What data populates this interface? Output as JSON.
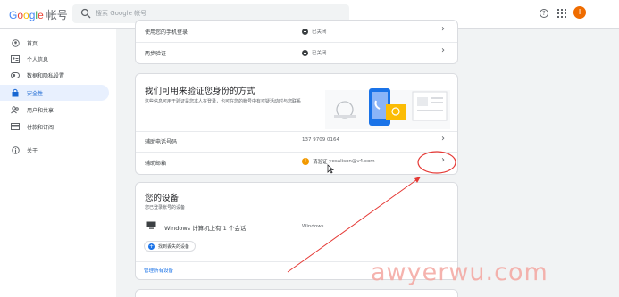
{
  "header": {
    "logo_letters": [
      "G",
      "o",
      "o",
      "g",
      "l",
      "e"
    ],
    "logo_suffix": "帐号",
    "search_placeholder": "搜索 Google 帐号",
    "help_symbol": "?",
    "avatar_letter": "I",
    "avatar_color": "#ef6c00"
  },
  "sidebar": {
    "items": [
      {
        "label": "首页",
        "icon": "account-circle-icon"
      },
      {
        "label": "个人信息",
        "icon": "id-card-icon"
      },
      {
        "label": "数据和隐私设置",
        "icon": "toggle-icon"
      },
      {
        "label": "安全性",
        "icon": "lock-icon",
        "active": true
      },
      {
        "label": "用户和共享",
        "icon": "people-icon"
      },
      {
        "label": "付款和订阅",
        "icon": "credit-card-icon"
      },
      {
        "label": "关于",
        "icon": "info-icon"
      }
    ]
  },
  "signin_card": {
    "rows": [
      {
        "label": "使用您的手机登录",
        "status": "已关闭"
      },
      {
        "label": "两步验证",
        "status": "已关闭"
      }
    ]
  },
  "verify_card": {
    "title": "我们可用来验证您身份的方式",
    "description": "这些信息可用于验证是您本人在登录，也可在您的帐号中有可疑活动时与您联系",
    "rows": [
      {
        "label": "辅助电话号码",
        "value": "137 9709 0164"
      },
      {
        "label": "辅助邮箱",
        "status_prefix": "请验证",
        "value": "yesalison@v4.com"
      }
    ]
  },
  "devices_card": {
    "title": "您的设备",
    "subtitle": "您已登录帐号的设备",
    "device_label": "Windows 计算机上有 1 个会话",
    "device_os": "Windows",
    "find_button": "找到丢失的设备",
    "manage_link": "管理所有设备"
  },
  "watermark": "awyerwu.com",
  "colors": {
    "accent": "#1a73e8",
    "annotation_red": "#e53935",
    "warn": "#f29900"
  }
}
